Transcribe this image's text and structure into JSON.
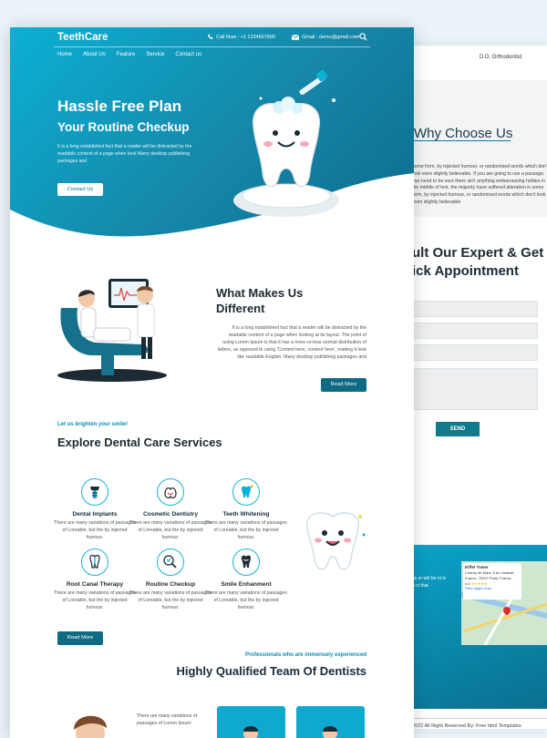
{
  "front": {
    "logo": "TeethCare",
    "call": "Call Now : +1 1234567890",
    "email": "Gmail : demo@gmail.com",
    "nav": [
      "Home",
      "About Us",
      "Feature",
      "Service",
      "Contact us"
    ],
    "hero": {
      "title": "Hassle Free Plan",
      "subtitle": "Your Routine Checkup",
      "text": "It is a long established fact that a reader will be distracted by the readable content of a page when look Many desktop publishing packages and",
      "button": "Contact Us"
    },
    "different": {
      "title_line1": "What Makes Us",
      "title_line2": "Different",
      "text": "It is a long established fact that a reader will be distracted by the readable content of a page when looking at its layout. The point of using Lorem Ipsum is that it has a more-or-less normal distribution of letters, as opposed to using 'Content here, content here', making it look like readable English. Many desktop publishing packages and",
      "button": "Read More"
    },
    "services": {
      "tagline": "Let us brighten your smile!",
      "title": "Explore Dental Care Services",
      "items": [
        {
          "title": "Dental Implants",
          "text": "There are many variations of passages of Loreable, but the by injected humour.",
          "icon": "implant-icon"
        },
        {
          "title": "Cosmetic Dentistry",
          "text": "There are many variations of passages of Loreable, but the by injected humour.",
          "icon": "cosmetic-icon"
        },
        {
          "title": "Teeth Whitening",
          "text": "There are many variations of passages of Loreable, but the by injected humour.",
          "icon": "whitening-icon"
        },
        {
          "title": "Root Canal Therapy",
          "text": "There are many variations of passages of Loreable, but the by injected humour.",
          "icon": "root-canal-icon"
        },
        {
          "title": "Routine Checkup",
          "text": "There are many variations of passages of Loreable, but the by injected humour.",
          "icon": "checkup-icon"
        },
        {
          "title": "Smile Enhanment",
          "text": "There are many variations of passages of Loreable, but the by injected humour.",
          "icon": "smile-icon"
        }
      ],
      "button": "Read More"
    },
    "team": {
      "tagline": "Professionals who are immensely experienced",
      "title": "Highly Qualified Team Of Dentists",
      "text": "There are many variations of passages of Lorem Ipsum"
    }
  },
  "back": {
    "doctor": "D.D. Orthodontist",
    "why_title": "Why Choose Us",
    "why_text": "some form, by injected humour, or randomised words which don't look even slightly believable. If you are going to use a passage, you need to be sure there isn't anything embarrassing hidden in the middle of text. the majority have suffered alteration in some form, by injected humour, or randomised words which don't look even slightly believable",
    "consult_line1": "ult Our Expert & Get",
    "consult_line2": "ick Appointment",
    "send": "SEND",
    "map_title": "Eiffel Tower",
    "map_address": "Champ de Mars, 5 Av. Anatole France, 75007 Paris, France",
    "map_rating": "4.6",
    "map_link": "View larger map",
    "footer_text": "gs er will be nt is a ct that",
    "copyright": "2022 All Right Reserved By: Free html Templates"
  },
  "colors": {
    "accent": "#0bb0d4",
    "dark_teal": "#0f6a84",
    "heading": "#1b2a33"
  }
}
